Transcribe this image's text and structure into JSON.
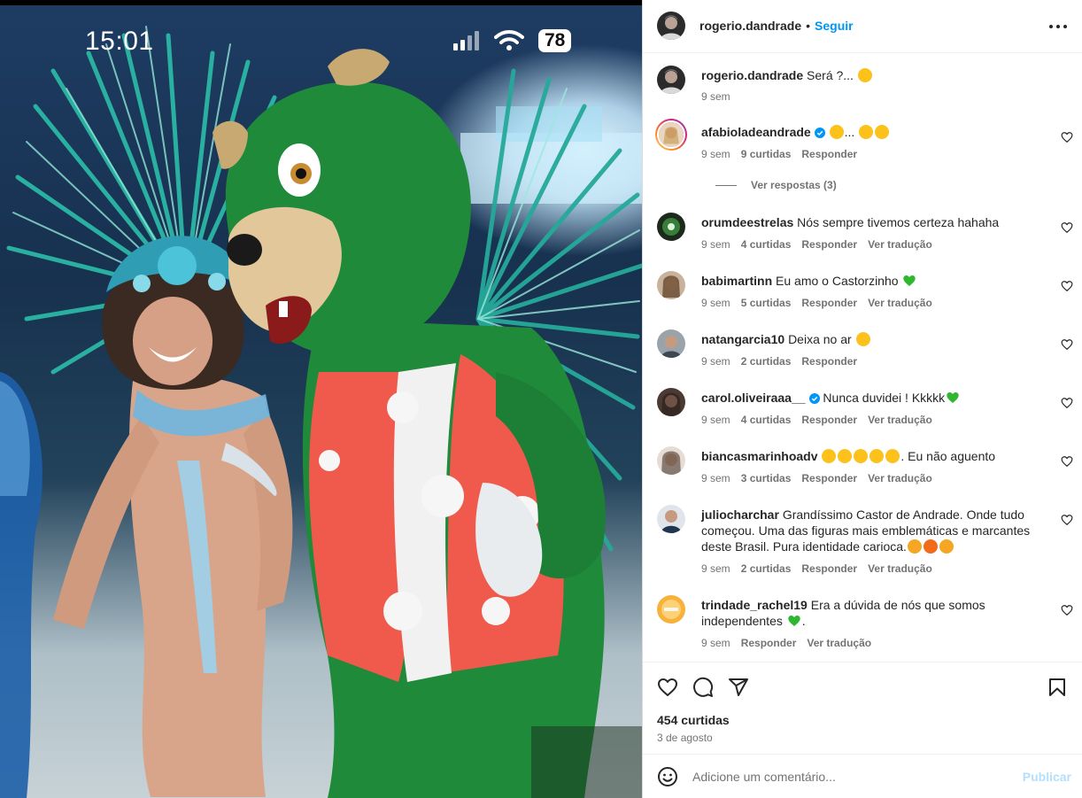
{
  "media": {
    "status_time": "15:01",
    "battery_level": "78",
    "icons": [
      "signal-icon",
      "wifi-icon",
      "battery-icon"
    ]
  },
  "header": {
    "username": "rogerio.dandrade",
    "separator": "•",
    "follow_label": "Seguir",
    "icons": [
      "more-options-icon"
    ]
  },
  "caption": {
    "username": "rogerio.dandrade",
    "text": "Será ?...",
    "time": "9 sem"
  },
  "comments": [
    {
      "username": "afabioladeandrade",
      "verified": true,
      "text": "...",
      "time": "9 sem",
      "likes": "9 curtidas",
      "reply": "Responder",
      "translate": "",
      "view_replies": "Ver respostas (3)"
    },
    {
      "username": "orumdeestrelas",
      "verified": false,
      "text": "Nós sempre tivemos certeza hahaha",
      "time": "9 sem",
      "likes": "4 curtidas",
      "reply": "Responder",
      "translate": "Ver tradução"
    },
    {
      "username": "babimartinn",
      "verified": false,
      "text": "Eu amo o Castorzinho",
      "time": "9 sem",
      "likes": "5 curtidas",
      "reply": "Responder",
      "translate": "Ver tradução"
    },
    {
      "username": "natangarcia10",
      "verified": false,
      "text": "Deixa no ar",
      "time": "9 sem",
      "likes": "2 curtidas",
      "reply": "Responder",
      "translate": ""
    },
    {
      "username": "carol.oliveiraaa__",
      "verified": true,
      "text": "Nunca duvidei ! Kkkkk",
      "time": "9 sem",
      "likes": "4 curtidas",
      "reply": "Responder",
      "translate": "Ver tradução"
    },
    {
      "username": "biancasmarinhoadv",
      "verified": false,
      "text": ". Eu não aguento",
      "time": "9 sem",
      "likes": "3 curtidas",
      "reply": "Responder",
      "translate": "Ver tradução"
    },
    {
      "username": "juliocharchar",
      "verified": false,
      "text": "Grandíssimo Castor de Andrade. Onde tudo começou. Uma das figuras mais emblemáticas e marcantes deste Brasil. Pura identidade carioca.",
      "time": "9 sem",
      "likes": "2 curtidas",
      "reply": "Responder",
      "translate": "Ver tradução"
    },
    {
      "username": "trindade_rachel19",
      "verified": false,
      "text": "Era a dúvida de nós que somos independentes",
      "text_end": ".",
      "time": "9 sem",
      "likes": "",
      "reply": "Responder",
      "translate": "Ver tradução"
    }
  ],
  "actions": {
    "icons": [
      "like-icon",
      "comment-icon",
      "share-icon",
      "save-icon"
    ],
    "likes_count": "454 curtidas",
    "date": "3 de agosto"
  },
  "add_comment": {
    "placeholder": "Adicione um comentário...",
    "publish_label": "Publicar"
  },
  "colors": {
    "accent": "#0095f6",
    "publish_disabled": "#b2dffc",
    "muted_text": "#737373",
    "mascot_green": "#1f8a3a",
    "vest_red": "#ef5a4c"
  }
}
